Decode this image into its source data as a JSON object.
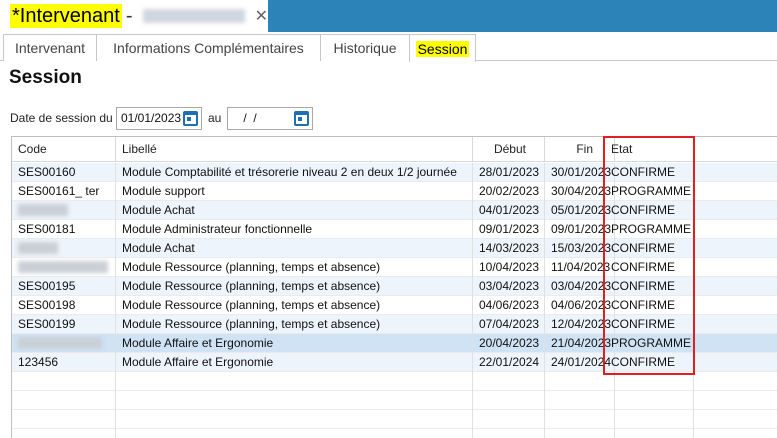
{
  "window": {
    "title": "*Intervenant",
    "separator": "-",
    "close_glyph": "✕"
  },
  "tabs": [
    {
      "label": "Intervenant"
    },
    {
      "label": "Informations Complémentaires"
    },
    {
      "label": "Historique"
    },
    {
      "label": "Session"
    }
  ],
  "page": {
    "title": "Session"
  },
  "filter": {
    "from_label": "Date de session du",
    "from_value": "01/01/2023",
    "to_label": "au",
    "to_value": " /  /"
  },
  "grid": {
    "columns": [
      "Code",
      "Libellé",
      "Début",
      "Fin",
      "Etat"
    ],
    "rows": [
      {
        "code": "SES00160",
        "libelle": "Module Comptabilité et trésorerie niveau 2 en deux 1/2 journée",
        "debut": "28/01/2023",
        "fin": "30/01/2023",
        "etat": "CONFIRME"
      },
      {
        "code": "SES00161_ ter",
        "libelle": "Module support",
        "debut": "20/02/2023",
        "fin": "30/04/2023",
        "etat": "PROGRAMME"
      },
      {
        "code": "",
        "libelle": "Module Achat",
        "debut": "04/01/2023",
        "fin": "05/01/2023",
        "etat": "CONFIRME"
      },
      {
        "code": "SES00181",
        "libelle": "Module Administrateur fonctionnelle",
        "debut": "09/01/2023",
        "fin": "09/01/2023",
        "etat": "PROGRAMME"
      },
      {
        "code": "",
        "libelle": "Module Achat",
        "debut": "14/03/2023",
        "fin": "15/03/2023",
        "etat": "CONFIRME"
      },
      {
        "code": "",
        "libelle": "Module Ressource (planning, temps et absence)",
        "debut": "10/04/2023",
        "fin": "11/04/2023",
        "etat": "CONFIRME"
      },
      {
        "code": "SES00195",
        "libelle": "Module Ressource (planning, temps et absence)",
        "debut": "03/04/2023",
        "fin": "03/04/2023",
        "etat": "CONFIRME"
      },
      {
        "code": "SES00198",
        "libelle": "Module Ressource (planning, temps et absence)",
        "debut": "04/06/2023",
        "fin": "04/06/2023",
        "etat": "CONFIRME"
      },
      {
        "code": "SES00199",
        "libelle": "Module Ressource (planning, temps et absence)",
        "debut": "07/04/2023",
        "fin": "12/04/2023",
        "etat": "CONFIRME"
      },
      {
        "code": "",
        "libelle": "Module Affaire et Ergonomie",
        "debut": "20/04/2023",
        "fin": "21/04/2023",
        "etat": "PROGRAMME"
      },
      {
        "code": "123456",
        "libelle": "Module Affaire et Ergonomie",
        "debut": "22/01/2024",
        "fin": "24/01/2024",
        "etat": "CONFIRME"
      }
    ],
    "selected_row": 9
  },
  "colors": {
    "accent": "#2b83b8",
    "highlight": "#ffff00",
    "annotation_border": "#e02020",
    "selected_row": "#cfe3f5",
    "calendar_icon": "#1f6fb5"
  },
  "icons": {
    "close": "close-icon",
    "calendar": "calendar-icon"
  }
}
